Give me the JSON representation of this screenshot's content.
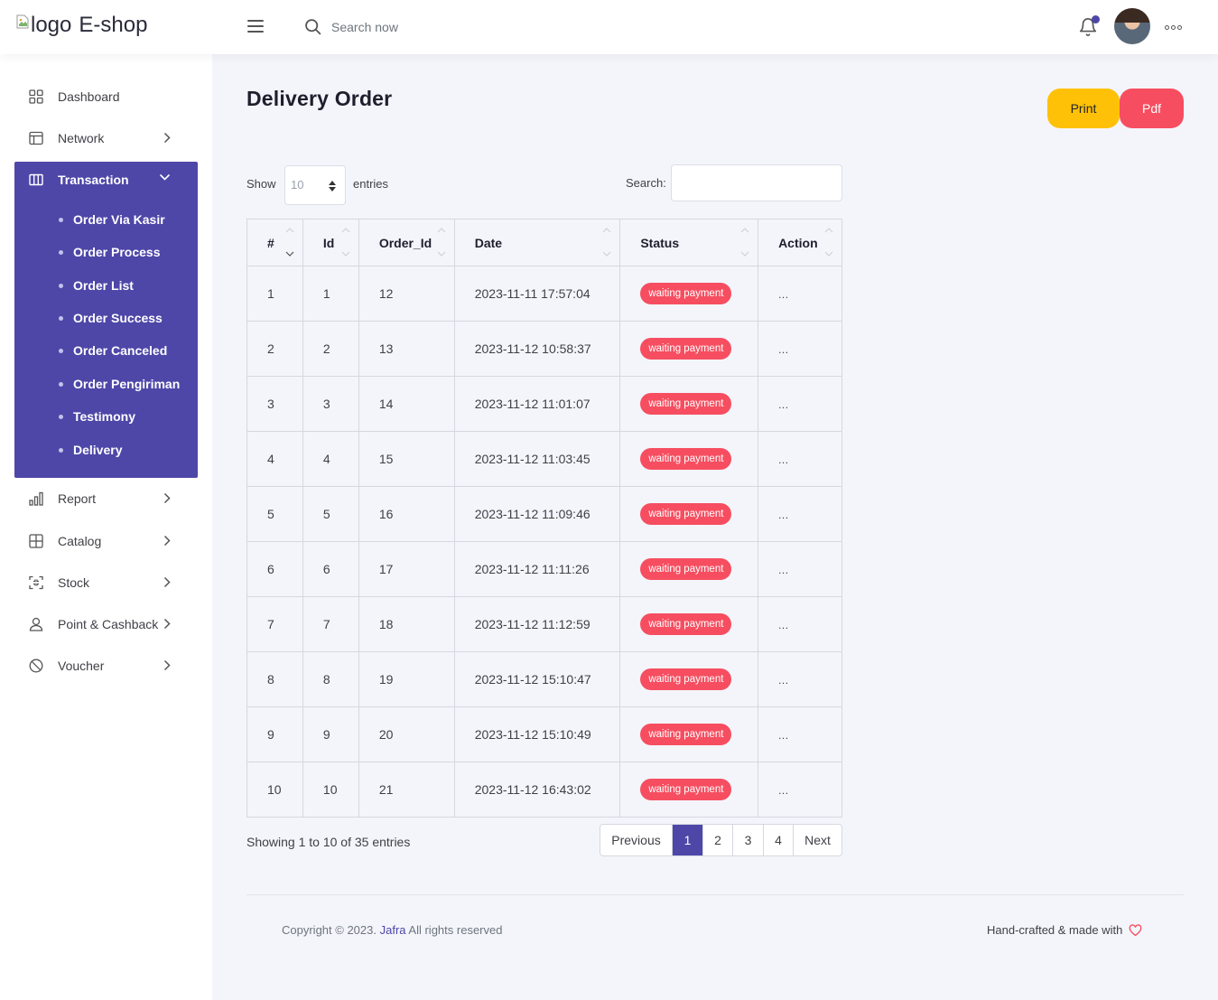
{
  "header": {
    "logo_alt": "logo",
    "brand": "E-shop",
    "search_placeholder": "Search now"
  },
  "sidebar": {
    "items": [
      {
        "label": "Dashboard",
        "icon": "dashboard-grid-icon"
      },
      {
        "label": "Network",
        "icon": "layout-icon"
      },
      {
        "label": "Transaction",
        "icon": "columns-icon",
        "expanded": true,
        "children": [
          "Order Via Kasir",
          "Order Process",
          "Order List",
          "Order Success",
          "Order Canceled",
          "Order Pengiriman",
          "Testimony",
          "Delivery"
        ]
      },
      {
        "label": "Report",
        "icon": "bar-chart-icon"
      },
      {
        "label": "Catalog",
        "icon": "grid-icon"
      },
      {
        "label": "Stock",
        "icon": "focus-corners-icon"
      },
      {
        "label": "Point & Cashback",
        "icon": "user-icon"
      },
      {
        "label": "Voucher",
        "icon": "slash-circle-icon"
      }
    ]
  },
  "main": {
    "title": "Delivery Order",
    "print_label": "Print",
    "pdf_label": "Pdf",
    "show_label": "Show",
    "page_length": "10",
    "entries_label": "entries",
    "search_label": "Search:",
    "columns": [
      "#",
      "Id",
      "Order_Id",
      "Date",
      "Status",
      "Action"
    ],
    "rows": [
      {
        "no": "1",
        "id": "1",
        "order_id": "12",
        "date": "2023-11-11 17:57:04",
        "status": "waiting payment",
        "action": "..."
      },
      {
        "no": "2",
        "id": "2",
        "order_id": "13",
        "date": "2023-11-12 10:58:37",
        "status": "waiting payment",
        "action": "..."
      },
      {
        "no": "3",
        "id": "3",
        "order_id": "14",
        "date": "2023-11-12 11:01:07",
        "status": "waiting payment",
        "action": "..."
      },
      {
        "no": "4",
        "id": "4",
        "order_id": "15",
        "date": "2023-11-12 11:03:45",
        "status": "waiting payment",
        "action": "..."
      },
      {
        "no": "5",
        "id": "5",
        "order_id": "16",
        "date": "2023-11-12 11:09:46",
        "status": "waiting payment",
        "action": "..."
      },
      {
        "no": "6",
        "id": "6",
        "order_id": "17",
        "date": "2023-11-12 11:11:26",
        "status": "waiting payment",
        "action": "..."
      },
      {
        "no": "7",
        "id": "7",
        "order_id": "18",
        "date": "2023-11-12 11:12:59",
        "status": "waiting payment",
        "action": "..."
      },
      {
        "no": "8",
        "id": "8",
        "order_id": "19",
        "date": "2023-11-12 15:10:47",
        "status": "waiting payment",
        "action": "..."
      },
      {
        "no": "9",
        "id": "9",
        "order_id": "20",
        "date": "2023-11-12 15:10:49",
        "status": "waiting payment",
        "action": "..."
      },
      {
        "no": "10",
        "id": "10",
        "order_id": "21",
        "date": "2023-11-12 16:43:02",
        "status": "waiting payment",
        "action": "..."
      }
    ],
    "info": "Showing 1 to 10 of 35 entries",
    "pagination": {
      "previous": "Previous",
      "pages": [
        "1",
        "2",
        "3",
        "4"
      ],
      "current": "1",
      "next": "Next"
    }
  },
  "footer": {
    "copyright_prefix": "Copyright © 2023.",
    "company": "Jafra",
    "copyright_suffix": "All rights reserved",
    "handcrafted": "Hand-crafted & made with"
  },
  "colors": {
    "primary": "#4e47a8",
    "danger": "#f64e60",
    "warning": "#ffc107",
    "background": "#f4f5fb"
  }
}
